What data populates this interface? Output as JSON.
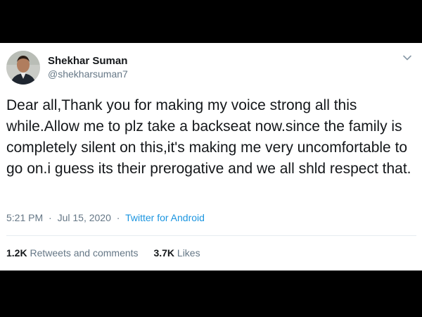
{
  "tweet": {
    "author": {
      "display_name": "Shekhar Suman",
      "handle": "@shekharsuman7"
    },
    "text": "Dear all,Thank you for making my voice strong all this while.Allow me to plz take a backseat now.since the family is completely silent on this,it's making me very uncomfortable to go on.i guess its their prerogative and we all shld respect that.",
    "time": "5:21 PM",
    "date": "Jul 15, 2020",
    "separator": "·",
    "source": "Twitter for Android",
    "stats": {
      "retweets_count": "1.2K",
      "retweets_label": "Retweets and comments",
      "likes_count": "3.7K",
      "likes_label": "Likes"
    }
  },
  "icons": {
    "menu": "chevron-down-icon",
    "avatar": "avatar-photo"
  },
  "colors": {
    "background": "#000000",
    "card": "#ffffff",
    "text_primary": "#14171a",
    "text_secondary": "#657786",
    "link": "#1b95e0",
    "divider": "#e6ecf0"
  }
}
